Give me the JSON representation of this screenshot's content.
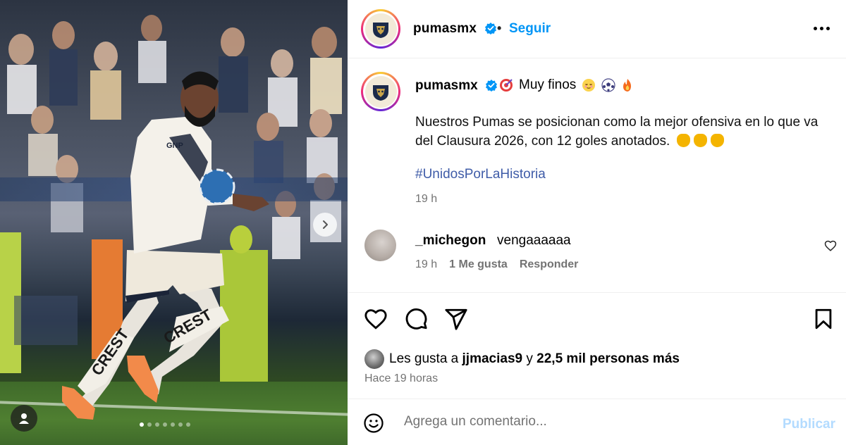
{
  "post": {
    "username": "pumasmx",
    "follow_label": "Seguir",
    "separator": "•",
    "caption": {
      "first_line": "Muy finos",
      "body": "Nuestros Pumas se posicionan como la mejor ofensiva en lo que va del Clausura 2026, con 12 goles anotados.",
      "hashtag": "#UnidosPorLaHistoria",
      "time": "19 h"
    },
    "comment": {
      "username": "_michegon",
      "text": "vengaaaaaa",
      "time": "19 h",
      "likes": "1 Me gusta",
      "reply": "Responder"
    },
    "likes": {
      "prefix": "Les gusta a",
      "user": "jjmacias9",
      "connector": "y",
      "others": "22,5 mil personas más"
    },
    "posted": "Hace 19 horas",
    "composer": {
      "placeholder": "Agrega un comentario...",
      "publish": "Publicar"
    },
    "carousel": {
      "slides": 7,
      "active": 1
    }
  },
  "colors": {
    "link_blue": "#0095f6",
    "hashtag": "#3f5ca8",
    "muted": "#737373",
    "publish_disabled": "#b3dbff"
  },
  "icons": [
    "verified-badge-icon",
    "more-options-icon",
    "heart-icon",
    "comment-icon",
    "share-icon",
    "bookmark-icon",
    "emoji-icon",
    "chevron-right-icon",
    "user-tag-icon"
  ]
}
